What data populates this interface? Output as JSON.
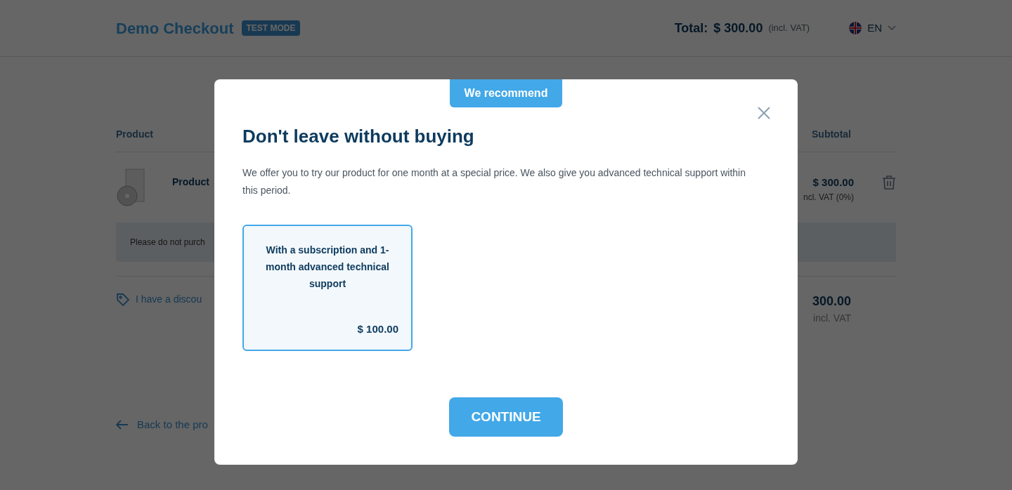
{
  "header": {
    "brand": "Demo Checkout",
    "badge": "TEST MODE",
    "total_label": "Total:",
    "total_value": "$ 300.00",
    "total_note": "(incl. VAT)",
    "language": "EN"
  },
  "cart": {
    "columns": [
      "Product",
      "Subtotal"
    ],
    "product_name": "Product",
    "price": "$ 300.00",
    "price_note": "ncl. VAT (0%)",
    "notice": "Please do not purch",
    "discount_link": "I have a discou",
    "grand_total": "300.00",
    "grand_total_note": "incl. VAT",
    "back_link": "Back to the pro"
  },
  "modal": {
    "ribbon": "We recommend",
    "title": "Don't leave without buying",
    "description": "We offer you to try our product for one month at a special price. We also give you advanced technical support within this period.",
    "offers": [
      {
        "title": "With a subscription and 1-month advanced technical support",
        "price": "$ 100.00",
        "selected": true
      }
    ],
    "button": "CONTINUE"
  }
}
